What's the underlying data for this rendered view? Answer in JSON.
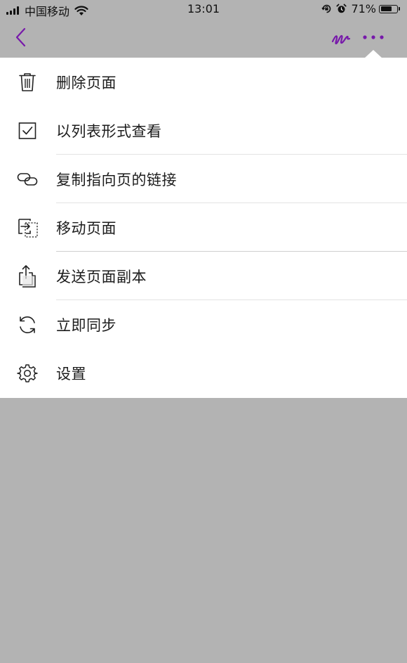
{
  "status_bar": {
    "carrier": "中国移动",
    "time": "13:01",
    "battery_percent": "71%",
    "battery_level": 0.71,
    "icons": [
      "signal-icon",
      "wifi-icon",
      "rotation-lock-icon",
      "alarm-icon",
      "battery-icon"
    ]
  },
  "nav": {
    "back_icon": "chevron-left-icon",
    "ink_icon": "ink-scribble-icon",
    "more_icon": "more-horizontal-icon",
    "accent_color": "#7719aa"
  },
  "menu": {
    "items": [
      {
        "label": "删除页面",
        "icon": "trash-icon"
      },
      {
        "label": "以列表形式查看",
        "icon": "checkbox-icon"
      },
      {
        "label": "复制指向页的链接",
        "icon": "link-icon"
      },
      {
        "label": "移动页面",
        "icon": "move-page-icon"
      },
      {
        "label": "发送页面副本",
        "icon": "share-icon"
      },
      {
        "label": "立即同步",
        "icon": "sync-icon"
      },
      {
        "label": "设置",
        "icon": "gear-icon"
      }
    ]
  },
  "colors": {
    "overlay": "#b3b3b3",
    "menu_background": "#ffffff",
    "accent": "#7719aa"
  }
}
